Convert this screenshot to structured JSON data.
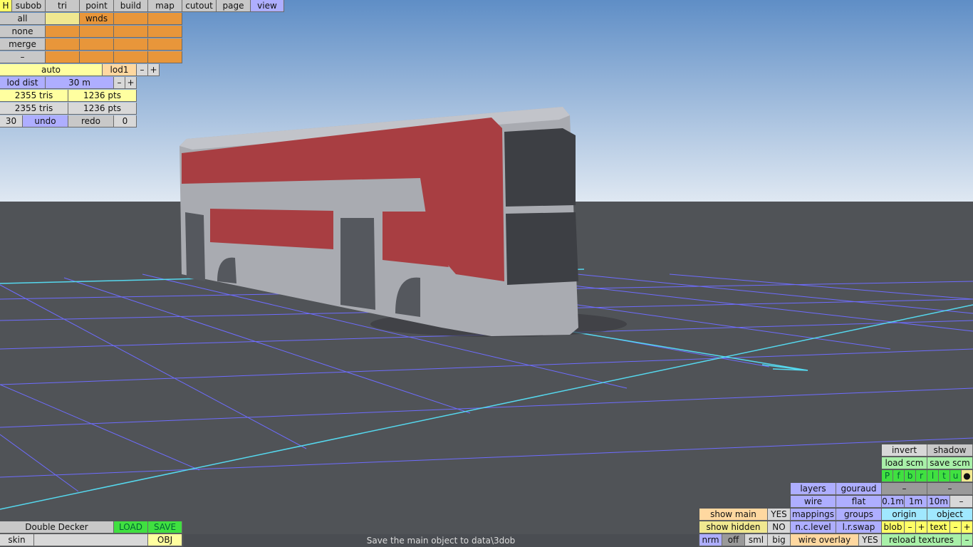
{
  "tabs": {
    "h": "H",
    "subob": "subob",
    "tri": "tri",
    "point": "point",
    "build": "build",
    "map": "map",
    "cutout": "cutout",
    "page": "page",
    "view": "view"
  },
  "select": {
    "all": "all",
    "none": "none",
    "merge": "merge",
    "minus": "–",
    "wnds": "wnds"
  },
  "lod": {
    "auto": "auto",
    "level": "lod1",
    "minus": "–",
    "plus": "+",
    "dist_label": "lod dist",
    "dist_value": "30 m"
  },
  "stats": {
    "tris1": "2355 tris",
    "pts1": "1236 pts",
    "tris2": "2355 tris",
    "pts2": "1236 pts"
  },
  "undo": {
    "count": "30",
    "undo": "undo",
    "redo": "redo",
    "redo_count": "0"
  },
  "file": {
    "name": "Double Decker",
    "load": "LOAD",
    "save": "SAVE",
    "skin": "skin",
    "obj": "OBJ"
  },
  "status_text": "Save the main object to data\\3dob",
  "right": {
    "invert": "invert",
    "shadow": "shadow",
    "load_scm": "load scm",
    "save_scm": "save scm",
    "flags": [
      "P",
      "f",
      "b",
      "r",
      "l",
      "t",
      "u",
      "●"
    ],
    "dash": "–",
    "layers": "layers",
    "gouraud": "gouraud",
    "wire": "wire",
    "flat": "flat",
    "d01": "0.1m",
    "d1": "1m",
    "d10": "10m",
    "show_main": "show main",
    "yes": "YES",
    "show_hidden": "show hidden",
    "no": "NO",
    "mappings": "mappings",
    "groups": "groups",
    "origin": "origin",
    "object": "object",
    "nc_level": "n.c.level",
    "lr_swap": "l.r.swap",
    "blob": "blob",
    "text": "text",
    "plus": "+",
    "nrm": "nrm",
    "off": "off",
    "sml": "sml",
    "big": "big",
    "wire_overlay": "wire overlay",
    "reload": "reload textures"
  },
  "colors": {
    "sky_top": "#5f8ec6",
    "sky_bottom": "#dfe8f2",
    "ground": "#505357",
    "grid": "#6e6cff",
    "bus_red": "#a83e42",
    "bus_body": "#a9abb1"
  }
}
